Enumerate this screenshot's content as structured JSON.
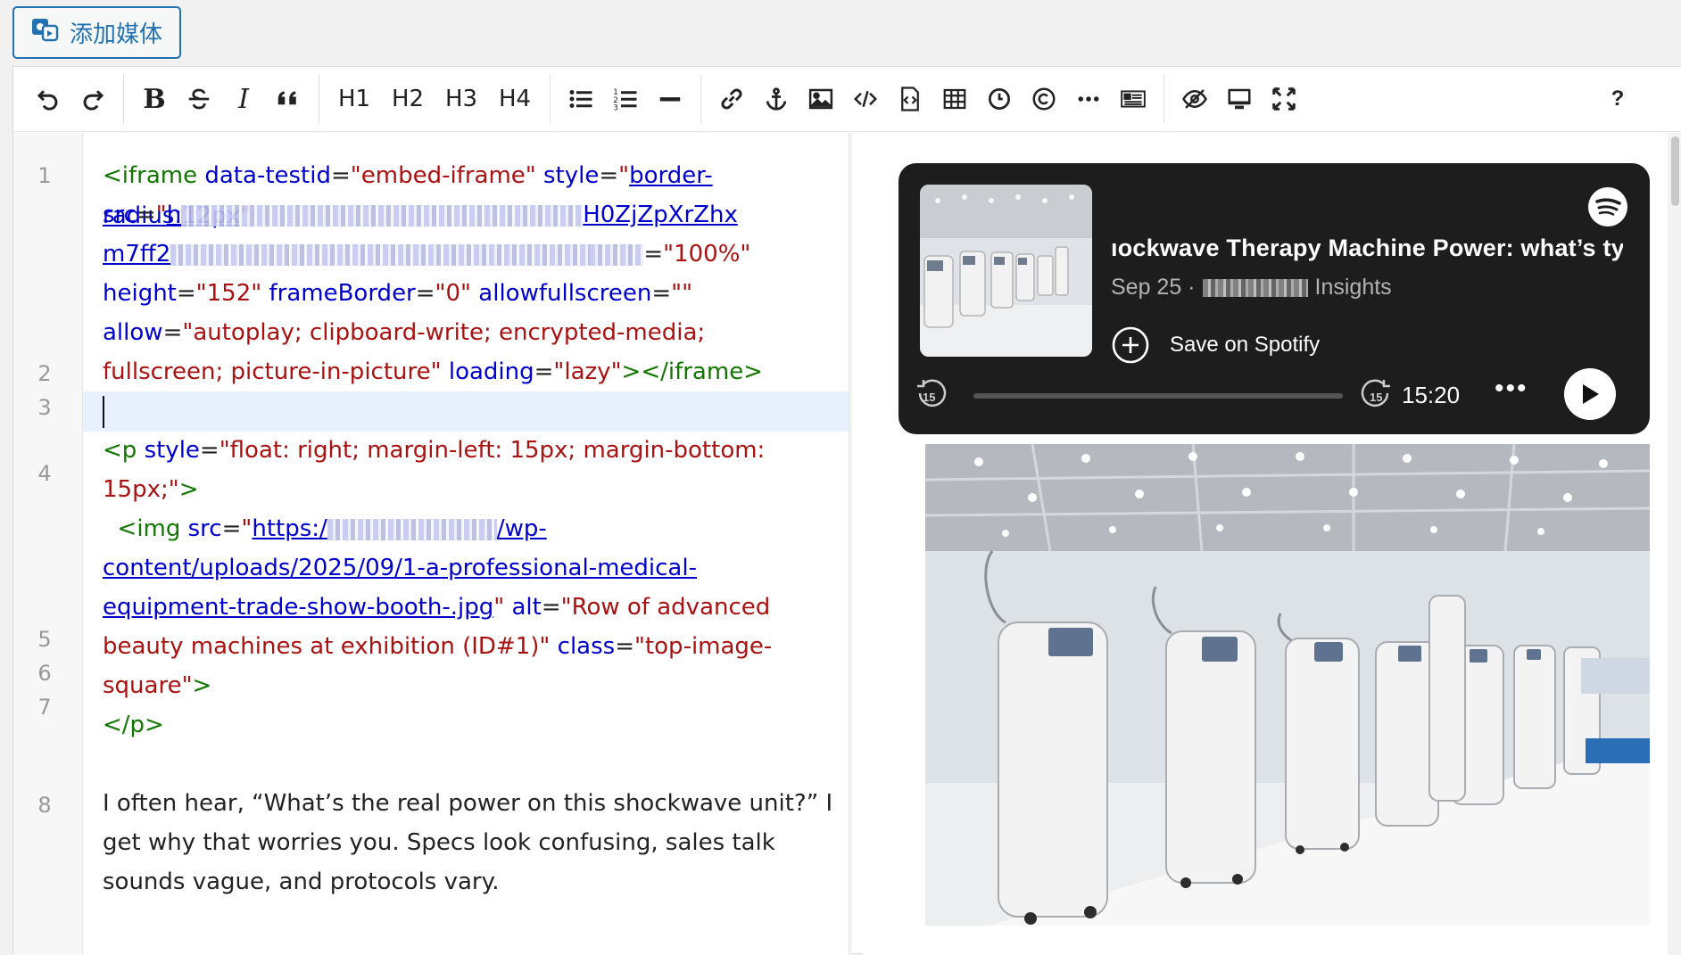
{
  "toolbar_top": {
    "add_media_label": "添加媒体"
  },
  "toolbar": {
    "buttons": [
      "undo-icon",
      "redo-icon",
      "bold",
      "strikethrough",
      "italic",
      "quote",
      "H1",
      "H2",
      "H3",
      "H4",
      "bullet-list",
      "numbered-list",
      "horizontal-rule",
      "link",
      "anchor",
      "image",
      "code",
      "embed",
      "table",
      "clock",
      "copyright",
      "more",
      "read-more",
      "preview-toggle",
      "fullscreen-preview",
      "fullscreen",
      "help"
    ],
    "headings": [
      "H1",
      "H2",
      "H3",
      "H4"
    ],
    "help": "?"
  },
  "editor": {
    "line_numbers": [
      "1",
      "2",
      "3",
      "4",
      "5",
      "6",
      "7",
      "8"
    ],
    "line1": {
      "open": "<iframe",
      "a1": "data-testid",
      "v1": "\"embed-iframe\"",
      "a2": "style",
      "v2": "border-radius:12px",
      "a3": "src",
      "v3_tail": "H0ZjZpXrZhx",
      "v3_line2_head": "m7ff2",
      "v4": "\"100%\"",
      "a5": "height",
      "v5": "\"152\"",
      "a6": "frameBorder",
      "v6": "\"0\"",
      "a7": "allowfullscreen",
      "v7": "\"\"",
      "a8": "allow",
      "v8": "\"autoplay; clipboard-write; encrypted-media;",
      "v8b": "fullscreen; picture-in-picture\"",
      "a9": "loading",
      "v9": "\"lazy\"",
      "close": "></iframe>"
    },
    "line3": {
      "open": "<p",
      "a1": "style",
      "v1": "\"float: right; margin-left: 15px; margin-bottom:",
      "v1b": "15px;\"",
      "close": ">"
    },
    "line4": {
      "open": "<img",
      "a1": "src",
      "v1_head": "https:/",
      "v1_tail": "/wp-",
      "v1b": "content/uploads/2025/09/1-a-professional-medical-",
      "v1c": "equipment-trade-show-booth-.jpg",
      "a2": "alt",
      "v2": "\"Row of advanced",
      "v2b": "beauty machines at exhibition (ID#1)\"",
      "a3": "class",
      "v3": "\"top-image-",
      "v3b": "square\"",
      "close": ">"
    },
    "line5": {
      "close": "</p>"
    },
    "line7": {
      "a": "I often hear, “What’s the real power on this shockwave unit?” I",
      "b": "get why that worries you. Specs look confusing, sales talk",
      "c": "sounds vague, and protocols vary."
    }
  },
  "preview": {
    "spotify": {
      "title": "ıockwave Therapy Machine Power: what’s ty",
      "date": "Sep 25 ·",
      "show_suffix": "Insights",
      "save_label": "Save on Spotify",
      "skip_back": "15",
      "skip_fwd": "15",
      "time": "15:20",
      "more": "•••",
      "progress": 0.0
    }
  }
}
